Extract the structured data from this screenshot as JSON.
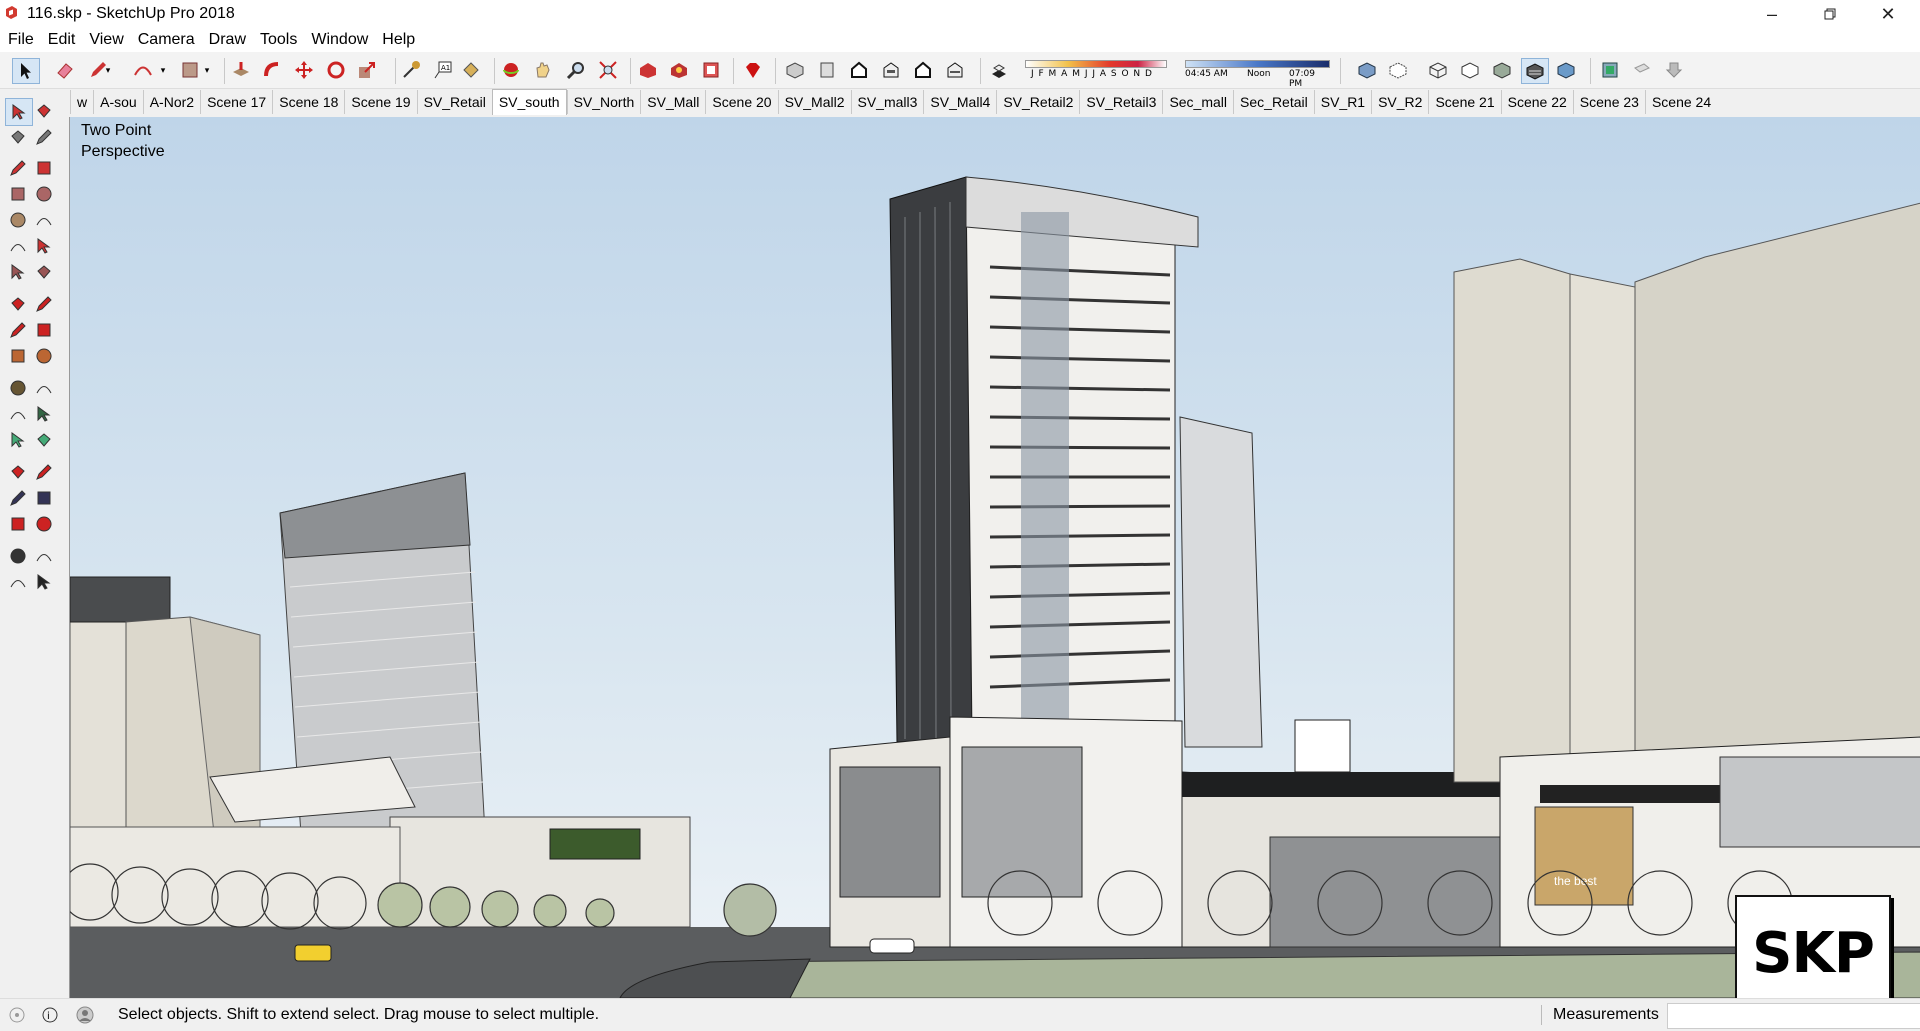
{
  "window": {
    "title": "116.skp - SketchUp Pro 2018"
  },
  "menu": [
    "File",
    "Edit",
    "View",
    "Camera",
    "Draw",
    "Tools",
    "Window",
    "Help"
  ],
  "shadow_bar": {
    "months": "J F M A M J J A S O N D",
    "time_start": "04:45 AM",
    "time_mid": "Noon",
    "time_end": "07:09 PM"
  },
  "scene_tabs": [
    "w",
    "A-sou",
    "A-Nor2",
    "Scene 17",
    "Scene 18",
    "Scene 19",
    "SV_Retail",
    "SV_south",
    "SV_North",
    "SV_Mall",
    "Scene 20",
    "SV_Mall2",
    "SV_mall3",
    "SV_Mall4",
    "SV_Retail2",
    "SV_Retail3",
    "Sec_mall",
    "Sec_Retail",
    "SV_R1",
    "SV_R2",
    "Scene 21",
    "Scene 22",
    "Scene 23",
    "Scene 24"
  ],
  "active_tab": "SV_south",
  "viewport": {
    "camera_line1": "Two Point",
    "camera_line2": "Perspective",
    "sign_text": "the best"
  },
  "watermark": "SKP",
  "status": {
    "hint": "Select objects. Shift to extend select. Drag mouse to select multiple.",
    "measurements_label": "Measurements",
    "measurements_value": ""
  },
  "toolbar_icons": [
    "select-icon",
    "eraser-icon",
    "pencil-icon",
    "arc-icon",
    "rectangle-icon",
    "push-pull-icon",
    "follow-me-icon",
    "move-icon",
    "rotate-icon",
    "scale-icon",
    "tape-measure-icon",
    "text-icon",
    "paint-bucket-icon",
    "orbit-icon",
    "pan-icon",
    "zoom-icon",
    "zoom-extents-icon",
    "3d-warehouse-icon",
    "extension-warehouse-icon",
    "layout-icon",
    "ruby-icon",
    "iso-view-icon",
    "top-view-icon",
    "front-view-icon",
    "right-view-icon",
    "back-view-icon",
    "left-view-icon",
    "shadows-icon",
    "xray-icon",
    "back-edges-icon",
    "wireframe-icon",
    "hidden-line-icon",
    "shaded-icon",
    "shaded-textures-icon",
    "monochrome-icon",
    "section-plane-icon",
    "section-display-icon",
    "section-cuts-icon"
  ],
  "colors": {
    "accent_red": "#c0392b",
    "sky_top": "#bfd5e9",
    "ground": "#a9b59a"
  }
}
